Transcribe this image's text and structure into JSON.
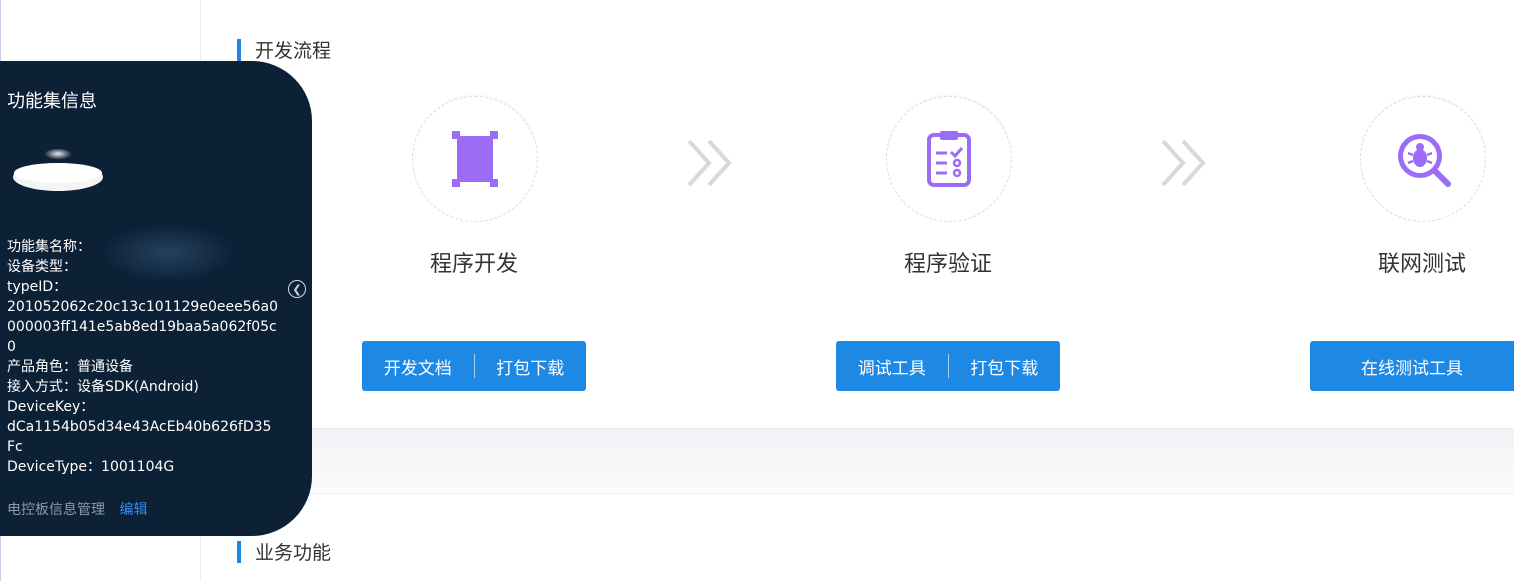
{
  "sections": {
    "dev_flow": "开发流程",
    "business": "业务功能"
  },
  "steps": [
    {
      "label": "程序开发",
      "icon": "crop-frame-icon",
      "buttons": [
        "开发文档",
        "打包下载"
      ]
    },
    {
      "label": "程序验证",
      "icon": "clipboard-check-icon",
      "buttons": [
        "调试工具",
        "打包下载"
      ]
    },
    {
      "label": "联网测试",
      "icon": "bug-search-icon",
      "buttons": [
        "在线测试工具"
      ]
    }
  ],
  "panel": {
    "title": "功能集信息",
    "name_label": "功能集名称：",
    "device_type_label": "设备类型：",
    "typeid_label": "typeID：",
    "typeid_value": "201052062c20c13c101129e0eee56a0000003ff141e5ab8ed19baa5a062f05c0",
    "role_label": "产品角色：",
    "role_value": "普通设备",
    "access_label": "接入方式：",
    "access_value": "设备SDK(Android)",
    "devicekey_label": "DeviceKey：",
    "devicekey_value": "dCa1154b05d34e43AcEb40b626fD35Fc",
    "devicetype_label": "DeviceType：",
    "devicetype_value": "1001104G",
    "footer_label": "电控板信息管理",
    "footer_edit": "编辑"
  },
  "colors": {
    "accent": "#1e88e5",
    "icon_purple": "#9b6cf5",
    "panel_bg": "#0c2036"
  }
}
